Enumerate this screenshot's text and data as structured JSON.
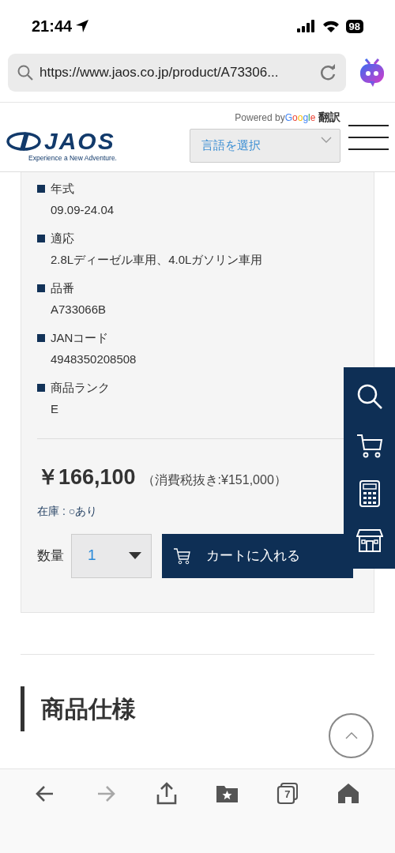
{
  "status_bar": {
    "time": "21:44",
    "battery": "98"
  },
  "browser": {
    "url": "https://www.jaos.co.jp/product/A73306..."
  },
  "header": {
    "logo_text": "JAOS",
    "tagline": "Experience a New Adventure.",
    "translate_powered": "Powered by",
    "translate_brand": "Google",
    "translate_label": "翻訳",
    "language_select": "言語を選択"
  },
  "specs": [
    {
      "label": "年式",
      "value": "09.09-24.04"
    },
    {
      "label": "適応",
      "value": "2.8Lディーゼル車用、4.0Lガソリン車用"
    },
    {
      "label": "品番",
      "value": "A733066B"
    },
    {
      "label": "JANコード",
      "value": "4948350208508"
    },
    {
      "label": "商品ランク",
      "value": "E"
    }
  ],
  "price": {
    "amount": "￥166,100",
    "tax_note": "（消費税抜き:¥151,000）"
  },
  "stock": "在庫 : ○あり",
  "quantity": {
    "label": "数量",
    "value": "1"
  },
  "cart_button": "カートに入れる",
  "section_title": "商品仕様",
  "toolbar": [
    {
      "kind": "back",
      "disabled": false
    },
    {
      "kind": "forward",
      "disabled": true
    },
    {
      "kind": "share",
      "disabled": false
    },
    {
      "kind": "bookmarks",
      "disabled": false
    },
    {
      "kind": "tabs",
      "label": "7",
      "disabled": false
    },
    {
      "kind": "home",
      "disabled": false
    }
  ]
}
